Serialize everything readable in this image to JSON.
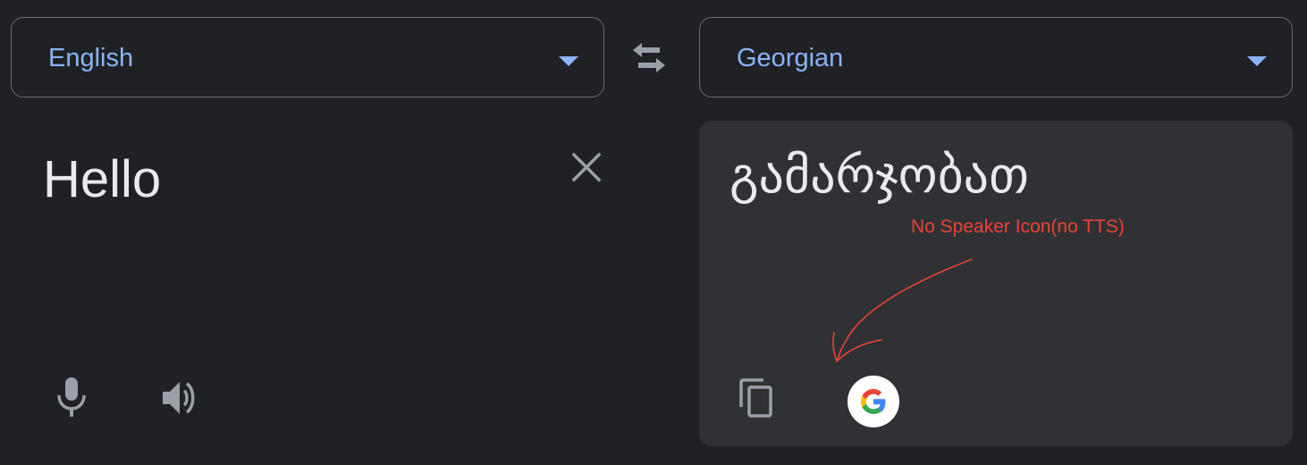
{
  "source_language": {
    "label": "English",
    "caret_icon": "caret-down-icon"
  },
  "swap": {
    "icon": "swap-arrows-icon"
  },
  "target_language": {
    "label": "Georgian",
    "caret_icon": "caret-down-icon"
  },
  "source_panel": {
    "text": "Hello",
    "clear_icon": "close-icon",
    "mic_icon": "microphone-icon",
    "speaker_icon": "speaker-icon"
  },
  "target_panel": {
    "text": "გამარჯობათ",
    "copy_icon": "copy-icon",
    "google_icon": "google-logo-icon"
  },
  "annotation": {
    "text": "No Speaker Icon(no TTS)"
  },
  "colors": {
    "background": "#202124",
    "output_panel": "#303134",
    "accent": "#8ab4f8",
    "text": "#e8eaed",
    "icon": "#9aa0a6",
    "annotation": "#ea4335"
  }
}
